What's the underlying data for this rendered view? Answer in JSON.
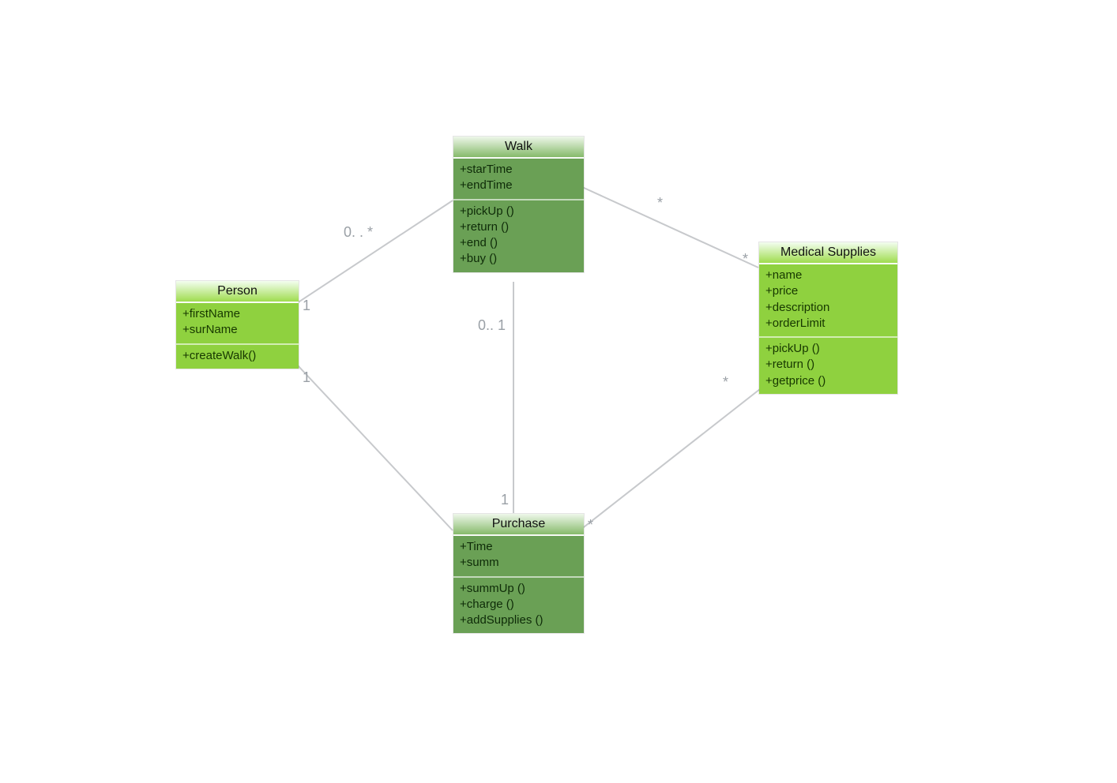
{
  "classes": {
    "person": {
      "title": "Person",
      "attributes": [
        "+firstName",
        "+surName"
      ],
      "operations": [
        "+createWalk()"
      ]
    },
    "walk": {
      "title": "Walk",
      "attributes": [
        "+starTime",
        "+endTime"
      ],
      "operations": [
        "+pickUp ()",
        "+return ()",
        "+end ()",
        "+buy ()"
      ]
    },
    "medical": {
      "title": "Medical Supplies",
      "attributes": [
        "+name",
        "+price",
        "+description",
        "+orderLimit"
      ],
      "operations": [
        "+pickUp ()",
        "+return ()",
        "+getprice ()"
      ]
    },
    "purchase": {
      "title": "Purchase",
      "attributes": [
        "+Time",
        "+summ"
      ],
      "operations": [
        "+summUp ()",
        "+charge ()",
        "+addSupplies ()"
      ]
    }
  },
  "edgeLabels": {
    "personWalk_person": "1",
    "personWalk_walk": "0. . *",
    "personPurchase_person": "1",
    "walkMedical_walk": "*",
    "walkMedical_medical": "*",
    "walkPurchase_walk": "0.. 1",
    "walkPurchase_purchase": "1",
    "purchaseMedical_purchase": "*",
    "purchaseMedical_medical": "*"
  }
}
